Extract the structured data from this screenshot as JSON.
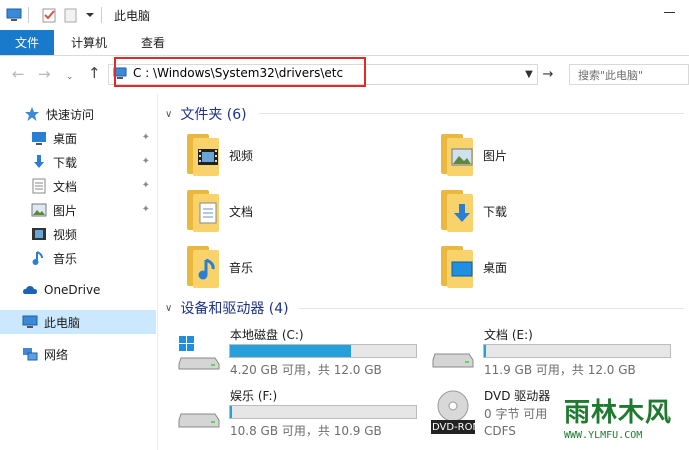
{
  "window": {
    "title": "此电脑"
  },
  "ribbon": {
    "tabs": [
      "文件",
      "计算机",
      "查看"
    ]
  },
  "address": {
    "path": "C : \\Windows\\System32\\drivers\\etc"
  },
  "search": {
    "placeholder": "搜索\"此电脑\""
  },
  "sidebar": {
    "items": [
      {
        "label": "快速访问",
        "icon": "star-icon"
      },
      {
        "label": "桌面",
        "icon": "desktop-icon",
        "pinned": true
      },
      {
        "label": "下载",
        "icon": "download-icon",
        "pinned": true
      },
      {
        "label": "文档",
        "icon": "document-icon",
        "pinned": true
      },
      {
        "label": "图片",
        "icon": "pictures-icon",
        "pinned": true
      },
      {
        "label": "视频",
        "icon": "video-icon"
      },
      {
        "label": "音乐",
        "icon": "music-icon"
      },
      {
        "label": "OneDrive",
        "icon": "cloud-icon"
      },
      {
        "label": "此电脑",
        "icon": "computer-icon",
        "selected": true
      },
      {
        "label": "网络",
        "icon": "network-icon"
      }
    ]
  },
  "folders": {
    "header": "文件夹 (6)",
    "items": [
      {
        "label": "视频",
        "icon": "video-folder-icon"
      },
      {
        "label": "图片",
        "icon": "pictures-folder-icon"
      },
      {
        "label": "文档",
        "icon": "documents-folder-icon"
      },
      {
        "label": "下载",
        "icon": "downloads-folder-icon"
      },
      {
        "label": "音乐",
        "icon": "music-folder-icon"
      },
      {
        "label": "桌面",
        "icon": "desktop-folder-icon"
      }
    ]
  },
  "drives": {
    "header": "设备和驱动器 (4)",
    "items": [
      {
        "label": "本地磁盘 (C:)",
        "info": "4.20 GB 可用，共 12.0 GB",
        "used_fraction": 0.65,
        "icon": "windows-drive-icon"
      },
      {
        "label": "文档 (E:)",
        "info": "11.9 GB 可用，共 12.0 GB",
        "used_fraction": 0.01,
        "icon": "hard-drive-icon"
      },
      {
        "label": "娱乐 (F:)",
        "info": "10.8 GB 可用，共 10.9 GB",
        "used_fraction": 0.01,
        "icon": "hard-drive-icon"
      },
      {
        "label": "DVD 驱动器",
        "info": "0 字节 可用",
        "extra": "CDFS",
        "badge": "DVD-ROM",
        "icon": "dvd-drive-icon"
      }
    ]
  },
  "watermark": {
    "big": "雨林木风",
    "small": "WWW.YLMFU.COM"
  },
  "colors": {
    "accent": "#1979ca",
    "selected": "#cce8ff",
    "progress": "#26a0da",
    "highlight_box": "#e02b2b"
  }
}
